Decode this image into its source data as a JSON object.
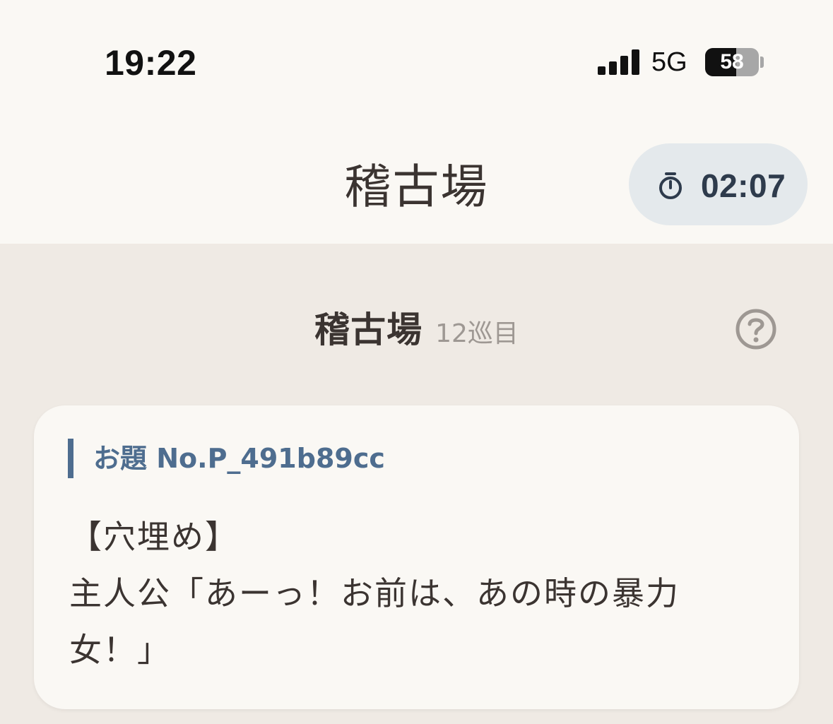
{
  "status_bar": {
    "time": "19:22",
    "network": "5G",
    "battery_percent": "58",
    "battery_level": 0.58
  },
  "header": {
    "title": "稽古場",
    "timer": "02:07",
    "timer_icon": "stopwatch-icon"
  },
  "section": {
    "title": "稽古場",
    "round": "12巡目",
    "help_icon": "help-circle-icon"
  },
  "card": {
    "prompt_label": "お題 No.P_491b89cc",
    "prompt_lines": [
      "【穴埋め】",
      "主人公「あーっ！お前は、あの時の暴力",
      "女！」"
    ]
  },
  "colors": {
    "background": "#efeae4",
    "header_bg": "#faf8f4",
    "card_bg": "#faf8f4",
    "accent": "#4e6d8f",
    "timer_pill": "#e4e9ec",
    "text": "#3b3431",
    "muted": "#9e9893"
  }
}
